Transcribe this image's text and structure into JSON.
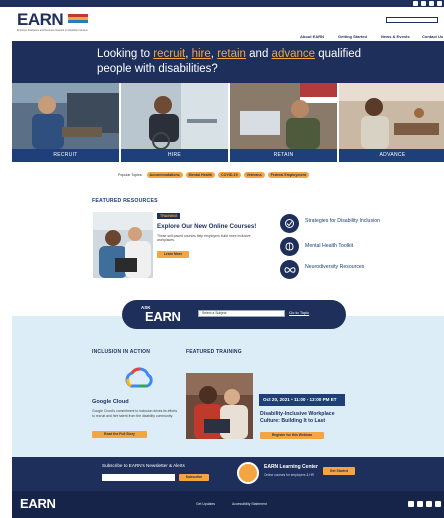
{
  "logo": {
    "text": "EARN",
    "tagline": "Employer Assistance and Resource Network on Disability Inclusion"
  },
  "header": {
    "nav": [
      "About EARN",
      "Getting Started",
      "News & Events",
      "Contact Us"
    ]
  },
  "hero": {
    "prefix": "Looking to ",
    "recruit": "recruit",
    "sep1": ", ",
    "hire": "hire",
    "sep2": ", ",
    "retain": "retain",
    "mid": " and ",
    "advance": "advance",
    "suffix": " qualified people with disabilities?"
  },
  "categories": [
    "RECRUIT",
    "HIRE",
    "RETAIN",
    "ADVANCE"
  ],
  "topics": {
    "label": "Popular Topics:",
    "items": [
      "Accommodations",
      "Mental Health",
      "COVID-19",
      "Veterans",
      "Federal Employment"
    ]
  },
  "featured": {
    "title": "FEATURED RESOURCES",
    "badge": "TRAINING",
    "headline": "Explore Our New Online Courses!",
    "description": "These self-paced courses help employers build more inclusive workplaces.",
    "button": "Learn More",
    "resources": [
      "Strategies for Disability Inclusion",
      "Mental Health Toolkit",
      "Neurodiversity Resources"
    ]
  },
  "ask": {
    "small": "ASK",
    "big": "EARN",
    "select_placeholder": "Select a Subject",
    "go": "Go to Topic"
  },
  "inclusion": {
    "title": "INCLUSION IN ACTION",
    "company": "Google Cloud",
    "description": "Google Cloud's commitment to inclusion drives its efforts to recruit and hire talent from the disability community.",
    "button": "Read the Full Story"
  },
  "training": {
    "title": "FEATURED TRAINING",
    "date": "Oct 20, 2021 • 11:00 - 12:00 PM ET",
    "headline": "Disability-Inclusive Workplace Culture: Building It to Last",
    "button": "Register for this Webinar"
  },
  "newsletter": {
    "label": "Subscribe to EARN's Newsletter & Alerts",
    "button": "Subscribe"
  },
  "learning": {
    "title": "EARN Learning Center",
    "subtitle": "Online courses for employers & HR",
    "button": "Get Started"
  },
  "footer": {
    "logo": "EARN",
    "links": [
      "Get Updates",
      "Accessibility Statement"
    ]
  },
  "colors": {
    "navy": "#1e2f5c",
    "accent": "#f2a541",
    "band": "#dcedf8"
  },
  "icons": [
    "facebook-icon",
    "twitter-icon",
    "linkedin-icon",
    "youtube-icon",
    "search-icon"
  ]
}
